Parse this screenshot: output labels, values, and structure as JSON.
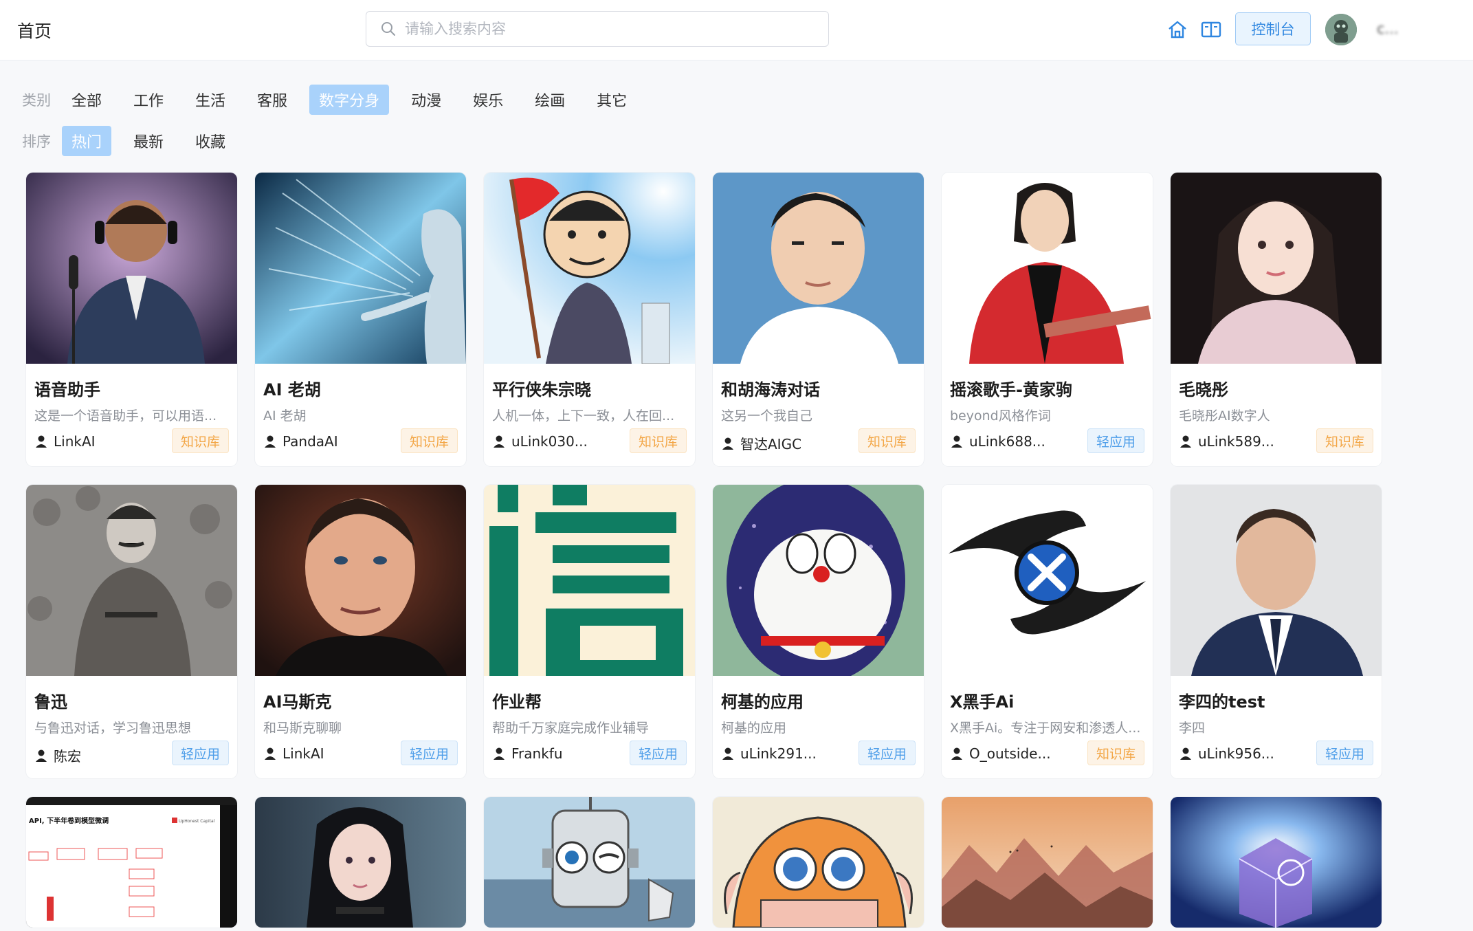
{
  "header": {
    "title": "首页",
    "search_placeholder": "请输入搜索内容",
    "console_label": "控制台",
    "username": "c..."
  },
  "filters": {
    "category_label": "类别",
    "categories": [
      "全部",
      "工作",
      "生活",
      "客服",
      "数字分身",
      "动漫",
      "娱乐",
      "绘画",
      "其它"
    ],
    "active_category": "数字分身",
    "sort_label": "排序",
    "sorts": [
      "热门",
      "最新",
      "收藏"
    ],
    "active_sort": "热门"
  },
  "cards": [
    {
      "title": "语音助手",
      "desc": "这是一个语音助手，可以用语...",
      "author": "LinkAI",
      "tag": "知识库",
      "tag_type": "kb",
      "image": "singer-with-headphones"
    },
    {
      "title": "AI 老胡",
      "desc": "AI 老胡",
      "author": "PandaAI",
      "tag": "知识库",
      "tag_type": "kb",
      "image": "woman-touching-light"
    },
    {
      "title": "平行侠朱宗晓",
      "desc": "人机一体，上下一致，人在回...",
      "author": "uLink030...",
      "tag": "知识库",
      "tag_type": "kb",
      "image": "caricature-flag"
    },
    {
      "title": "和胡海涛对话",
      "desc": "这另一个我自己",
      "author": "智达AIGC",
      "tag": "知识库",
      "tag_type": "kb",
      "image": "portrait-young-man"
    },
    {
      "title": "摇滚歌手-黄家驹",
      "desc": "beyond风格作词",
      "author": "uLink688...",
      "tag": "轻应用",
      "tag_type": "app",
      "image": "guitarist"
    },
    {
      "title": "毛晓彤",
      "desc": "毛晓彤AI数字人",
      "author": "uLink589...",
      "tag": "知识库",
      "tag_type": "kb",
      "image": "woman-portrait"
    },
    {
      "title": "鲁迅",
      "desc": "与鲁迅对话，学习鲁迅思想",
      "author": "陈宏",
      "tag": "轻应用",
      "tag_type": "app",
      "image": "vintage-man"
    },
    {
      "title": "AI马斯克",
      "desc": "和马斯克聊聊",
      "author": "LinkAI",
      "tag": "轻应用",
      "tag_type": "app",
      "image": "man-portrait"
    },
    {
      "title": "作业帮",
      "desc": "帮助千万家庭完成作业辅导",
      "author": "Frankfu",
      "tag": "轻应用",
      "tag_type": "app",
      "image": "green-character-logo"
    },
    {
      "title": "柯基的应用",
      "desc": "柯基的应用",
      "author": "uLink291...",
      "tag": "轻应用",
      "tag_type": "app",
      "image": "cartoon-cat"
    },
    {
      "title": "X黑手Ai",
      "desc": "X黑手Ai。专注于网安和渗透人...",
      "author": "O_outside...",
      "tag": "知识库",
      "tag_type": "kb",
      "image": "x-logo"
    },
    {
      "title": "李四的test",
      "desc": "李四",
      "author": "uLink956...",
      "tag": "轻应用",
      "tag_type": "app",
      "image": "man-in-suit"
    }
  ],
  "partial_cards": [
    {
      "image": "slide-diagram",
      "slide_title": "API, 下半年卷到模型微调",
      "slide_brand": "UpHonest Capital"
    },
    {
      "image": "cyber-girl"
    },
    {
      "image": "robot"
    },
    {
      "image": "cartoon-hat"
    },
    {
      "image": "mountain-landscape"
    },
    {
      "image": "glowing-cube"
    }
  ]
}
